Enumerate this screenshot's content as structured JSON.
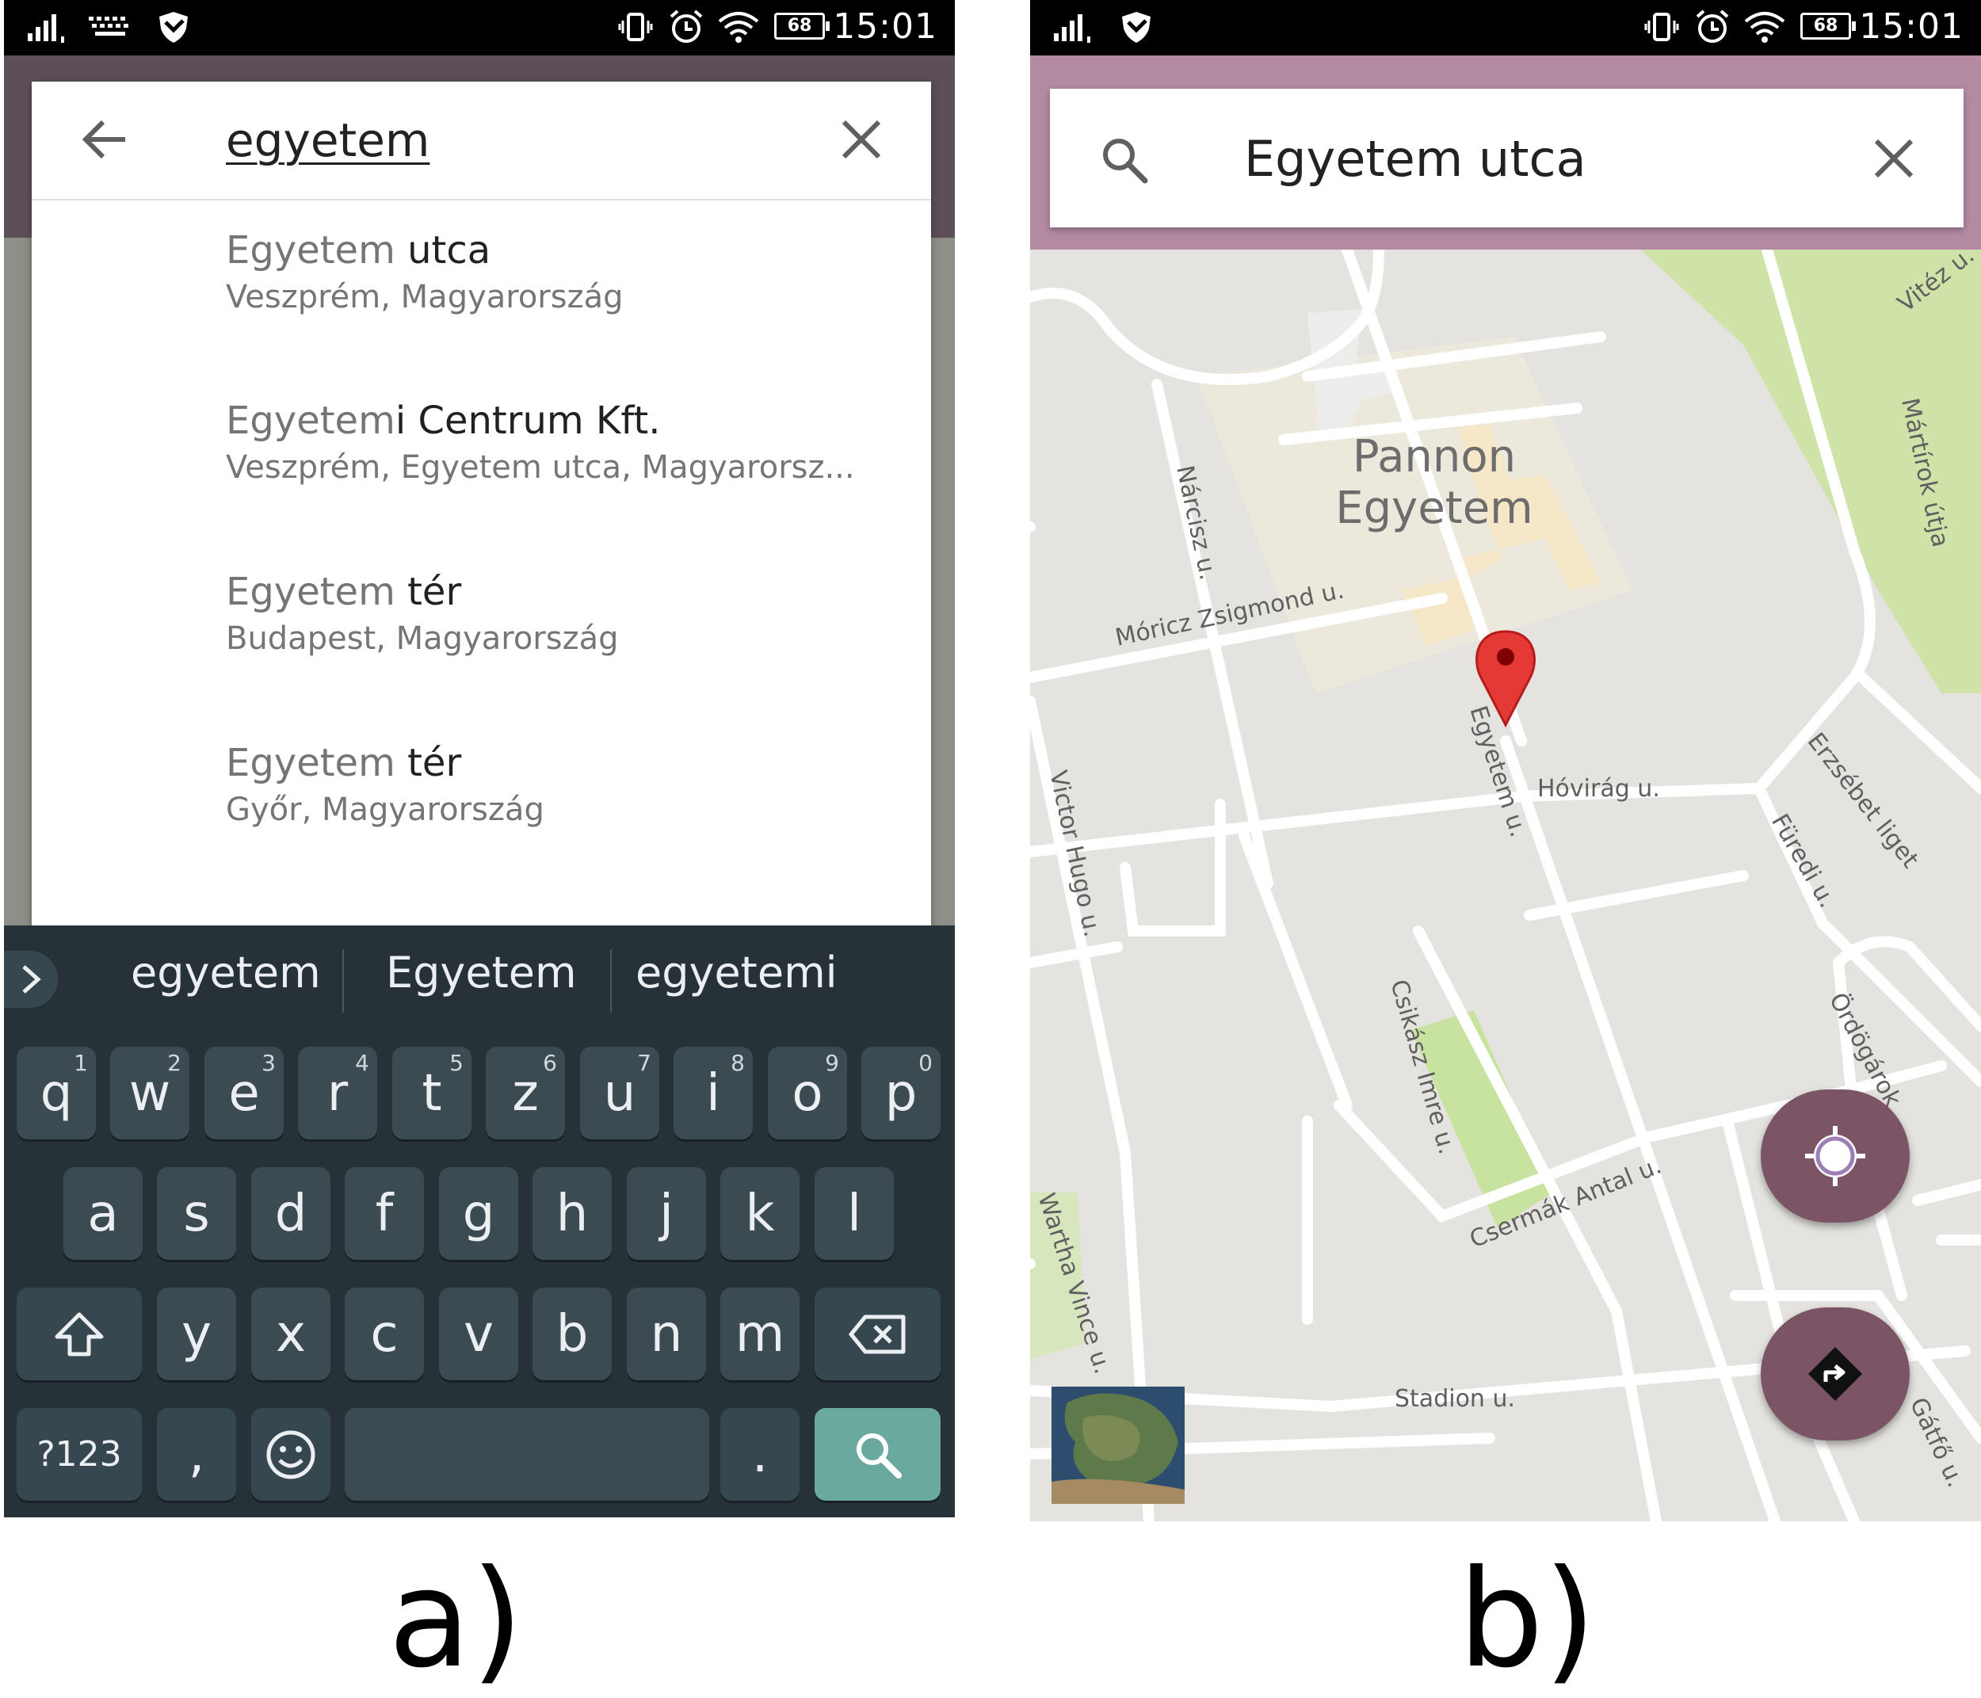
{
  "status_bar": {
    "time": "15:01",
    "battery": "68"
  },
  "panel_a": {
    "search": {
      "query": "egyetem"
    },
    "suggestions": [
      {
        "match": "Egyetem",
        "rest": " utca",
        "subtitle": "Veszprém, Magyarország"
      },
      {
        "match": "Egyetem",
        "rest": "i Centrum Kft.",
        "subtitle": "Veszprém, Egyetem utca, Magyarorsz..."
      },
      {
        "match": "Egyetem",
        "rest": " tér",
        "subtitle": "Budapest, Magyarország"
      },
      {
        "match": "Egyetem",
        "rest": " tér",
        "subtitle": "Győr, Magyarország"
      }
    ],
    "keyboard": {
      "suggestions": [
        "egyetem",
        "Egyetem",
        "egyetemi"
      ],
      "row1": [
        {
          "k": "q",
          "h": "1"
        },
        {
          "k": "w",
          "h": "2"
        },
        {
          "k": "e",
          "h": "3"
        },
        {
          "k": "r",
          "h": "4"
        },
        {
          "k": "t",
          "h": "5"
        },
        {
          "k": "z",
          "h": "6"
        },
        {
          "k": "u",
          "h": "7"
        },
        {
          "k": "i",
          "h": "8"
        },
        {
          "k": "o",
          "h": "9"
        },
        {
          "k": "p",
          "h": "0"
        }
      ],
      "row2": [
        "a",
        "s",
        "d",
        "f",
        "g",
        "h",
        "j",
        "k",
        "l"
      ],
      "row3": [
        "y",
        "x",
        "c",
        "v",
        "b",
        "n",
        "m"
      ],
      "symbols_label": "?123",
      "comma": ",",
      "period": "."
    },
    "caption": "a)"
  },
  "panel_b": {
    "search": {
      "query": "Egyetem utca"
    },
    "map": {
      "poi": [
        "Pannon",
        "Egyetem"
      ],
      "streets": {
        "narcisz": "Nárcisz u.",
        "moricz": "Móricz Zsigmond u.",
        "victor_hugo": "Victor Hugo u.",
        "egyetem": "Egyetem u.",
        "hovirag": "Hóvirág u.",
        "erzsebet": "Erzsébet liget",
        "furedi": "Füredi u.",
        "martirok": "Mártírok útja",
        "vitez": "Vitéz u.",
        "ordogarok": "Ördögárok",
        "csikasz": "Csikász Imre u.",
        "csermak": "Csermák Antal u.",
        "wartha": "Wartha Vince u.",
        "stadion": "Stadion u.",
        "gatfo": "Gátfő u."
      }
    },
    "caption": "b)"
  },
  "colors": {
    "accent": "#7b5566",
    "toolbar": "#b38aa2",
    "keyboard": "#263238",
    "key": "#3c4a52",
    "search_key": "#6aa99e",
    "pin": "#e53935"
  }
}
